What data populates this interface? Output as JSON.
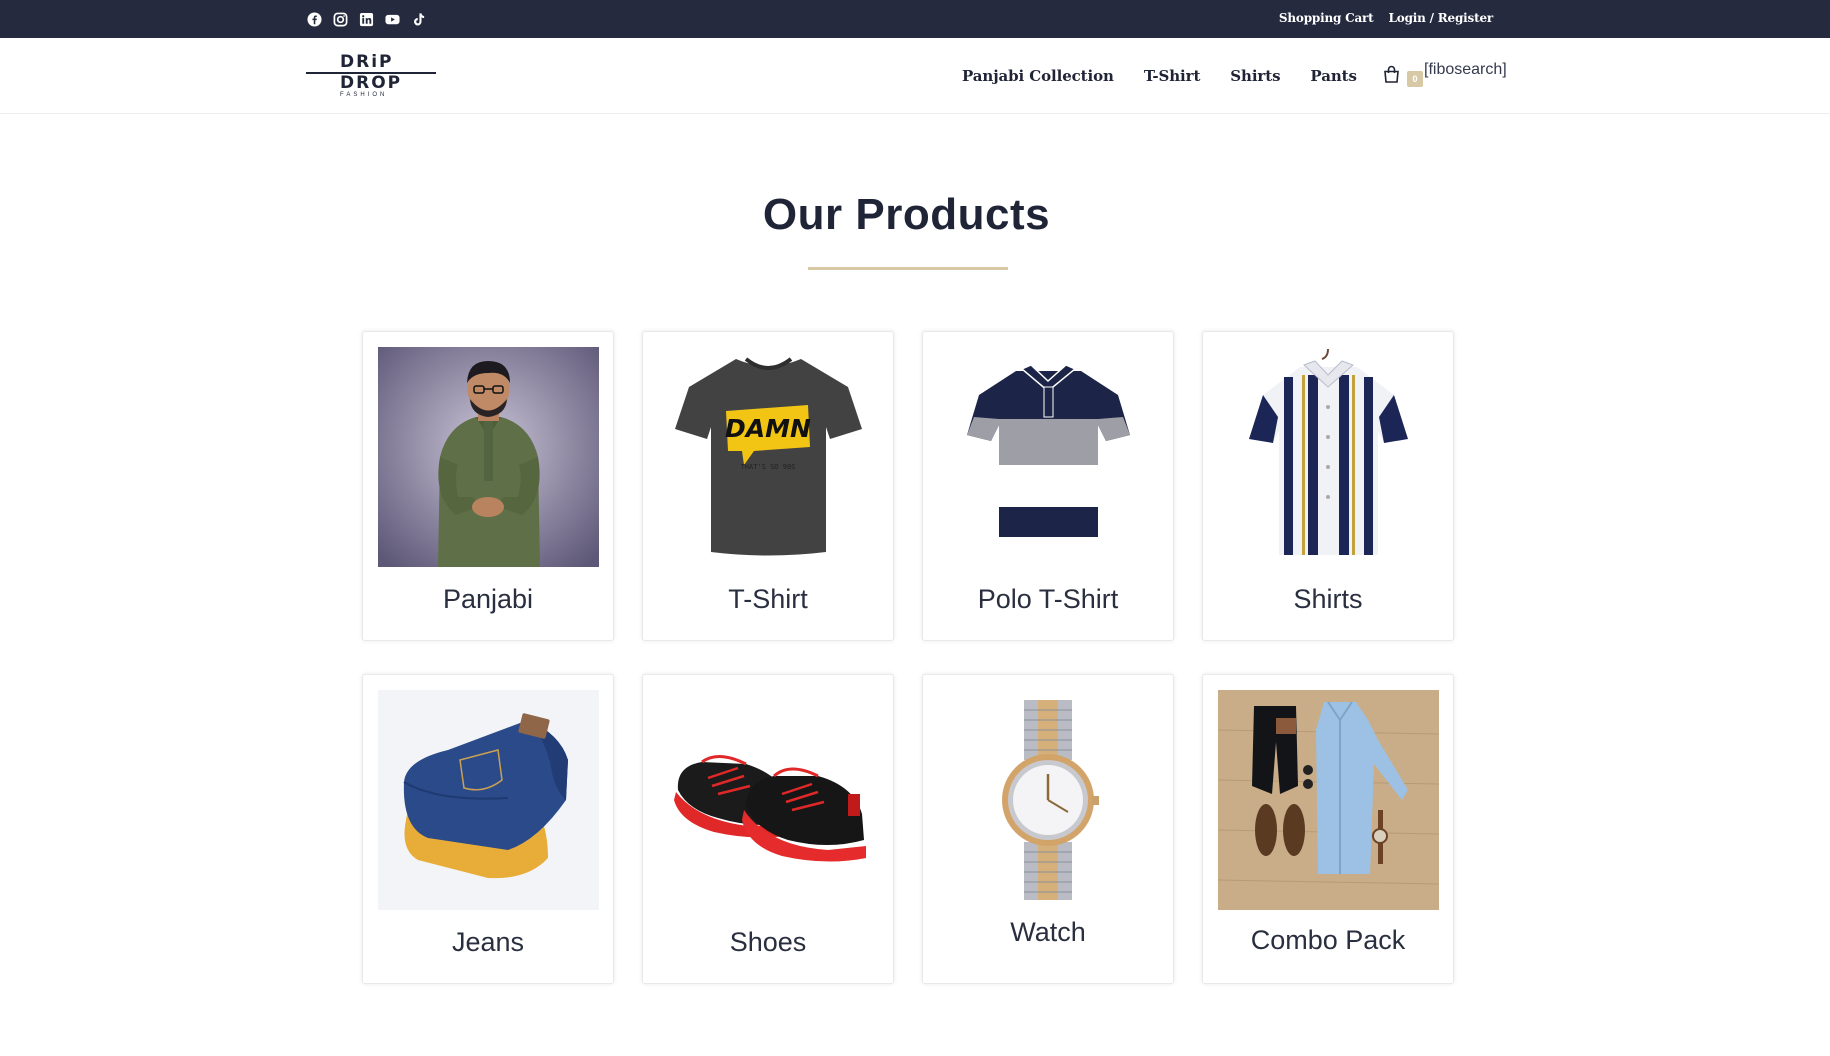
{
  "topbar": {
    "social_icons": [
      "facebook-icon",
      "instagram-icon",
      "linkedin-icon",
      "youtube-icon",
      "tiktok-icon"
    ],
    "shopping_cart": "Shopping Cart",
    "login_register": "Login / Register"
  },
  "header": {
    "logo": {
      "line1": "DRiP",
      "line2": "DROP",
      "line3": "FASHION"
    },
    "nav": [
      "Panjabi Collection",
      "T-Shirt",
      "Shirts",
      "Pants"
    ],
    "cart_count": "0",
    "search_placeholder": "[fibosearch]"
  },
  "section": {
    "title": "Our Products"
  },
  "products": [
    {
      "label": "Panjabi"
    },
    {
      "label": "T-Shirt"
    },
    {
      "label": "Polo T-Shirt"
    },
    {
      "label": "Shirts"
    },
    {
      "label": "Jeans"
    },
    {
      "label": "Shoes"
    },
    {
      "label": "Watch"
    },
    {
      "label": "Combo Pack"
    }
  ],
  "tshirt_print": {
    "big": "DAMN",
    "small": "THAT'S SO 90S"
  },
  "colors": {
    "topbar": "#252a3f",
    "accent": "#d8c9a6",
    "text": "#1f2437"
  }
}
